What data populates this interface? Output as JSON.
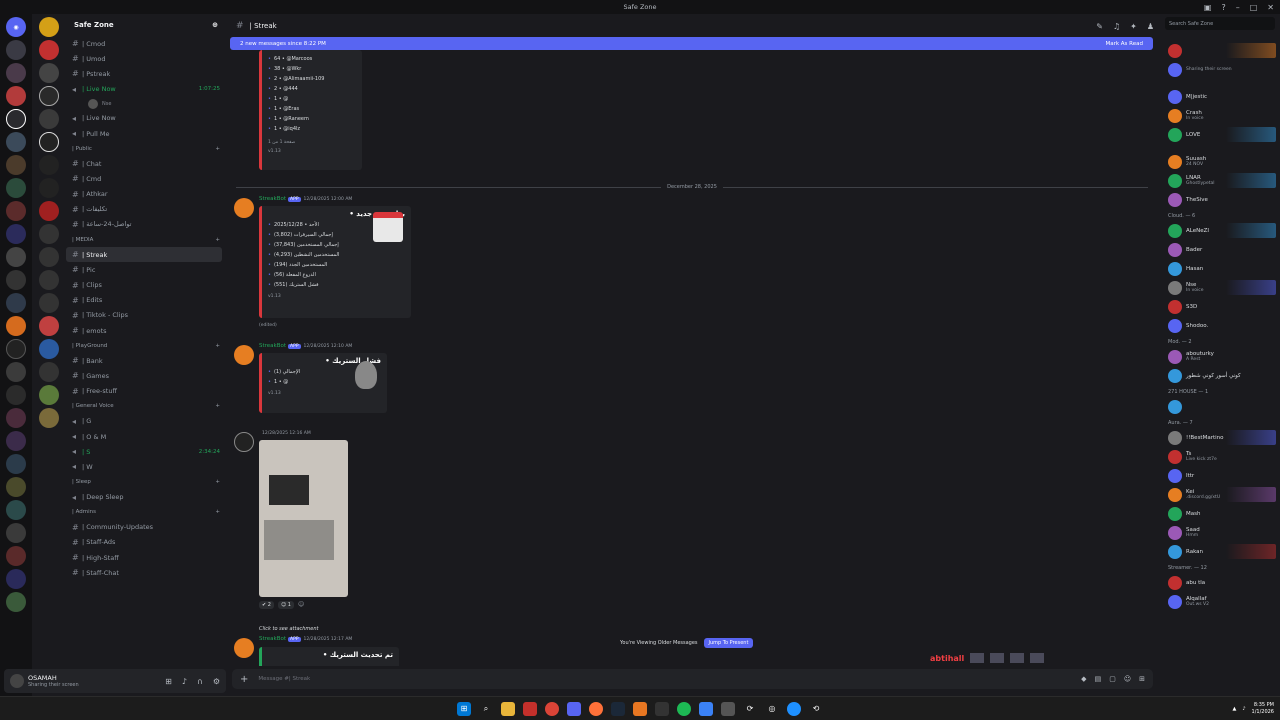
{
  "window": {
    "title": "Safe Zone"
  },
  "server": {
    "name": "Safe Zone"
  },
  "channels": [
    {
      "label": "| Cmod",
      "type": "text"
    },
    {
      "label": "| Umod",
      "type": "text"
    },
    {
      "label": "| Pstreak",
      "type": "text"
    },
    {
      "label": "| Live Now",
      "type": "voice",
      "time": "1:07:25",
      "live": true
    },
    {
      "label": "Nse",
      "type": "sub"
    },
    {
      "label": "| Live Now",
      "type": "voice"
    },
    {
      "label": "| Pull Me",
      "type": "voice"
    },
    {
      "label": "| Public",
      "type": "category"
    },
    {
      "label": "| Chat",
      "type": "text"
    },
    {
      "label": "| Cmd",
      "type": "text"
    },
    {
      "label": "| Athkar",
      "type": "text"
    },
    {
      "label": "| تكليفات",
      "type": "text"
    },
    {
      "label": "| تواصل-24-ساعة",
      "type": "text"
    },
    {
      "label": "| MEDIA",
      "type": "category"
    },
    {
      "label": "| Streak",
      "type": "text",
      "active": true
    },
    {
      "label": "| Pic",
      "type": "text"
    },
    {
      "label": "| Clips",
      "type": "text"
    },
    {
      "label": "| Edits",
      "type": "text"
    },
    {
      "label": "| Tiktok - Clips",
      "type": "text"
    },
    {
      "label": "| emots",
      "type": "text"
    },
    {
      "label": "| PlayGround",
      "type": "category"
    },
    {
      "label": "| Bank",
      "type": "text"
    },
    {
      "label": "| Games",
      "type": "text"
    },
    {
      "label": "| Free-stuff",
      "type": "text"
    },
    {
      "label": "| General Voice",
      "type": "category"
    },
    {
      "label": "| G",
      "type": "voice"
    },
    {
      "label": "| O & M",
      "type": "voice"
    },
    {
      "label": "| S",
      "type": "voice",
      "time": "2:34:24",
      "live": true
    },
    {
      "label": "| W",
      "type": "voice"
    },
    {
      "label": "| Sleep",
      "type": "category"
    },
    {
      "label": "| Deep Sleep",
      "type": "voice"
    },
    {
      "label": "| Admins",
      "type": "category"
    },
    {
      "label": "| Community-Updates",
      "type": "text"
    },
    {
      "label": "| Staff-Ads",
      "type": "text"
    },
    {
      "label": "| High-Staff",
      "type": "text"
    },
    {
      "label": "| Staff-Chat",
      "type": "text"
    }
  ],
  "user": {
    "name": "OSAMAH",
    "status": "Sharing their screen"
  },
  "chat": {
    "channel_name": "| Streak",
    "new_messages": "2 new messages since 8:22 PM",
    "mark_read": "Mark As Read",
    "day_separator": "December 28, 2025",
    "composer_placeholder": "Message #| Streak",
    "older_notice": "You're Viewing Older Messages",
    "jump_label": "Jump To Present",
    "typing_name": "abtihall"
  },
  "messages": [
    {
      "leaderboard": [
        "64 • @Marcoos",
        "38 • @Wkr",
        "2 • @Alimaamii-109",
        "2 • @444",
        "1 • @",
        "1 • @Eras",
        "1 • @Raneem",
        "1 • @iq4lz"
      ],
      "footer_text": "صفحة 1 من 1",
      "version": "v1.13"
    },
    {
      "author": "StreakBot",
      "tag": "APP",
      "time": "12/28/2025 12:00 AM",
      "title": "بداية يوم جديد •",
      "lines": [
        "الأحد • 2025/12/28",
        "إجمالي السيرفرات (3,802)",
        "إجمالي المستخدمين (37,843)",
        "المستخدمين النشطين (4,293)",
        "المستخدمين الجدد (194)",
        "الدروع المفعلة (56)",
        "فشل الستريك (551)"
      ],
      "version": "v1.13",
      "extra": "(edited)"
    },
    {
      "author": "StreakBot",
      "tag": "APP",
      "time": "12/28/2025 12:10 AM",
      "title": "فشل الستريك •",
      "lines": [
        "الإجمالي (1)",
        "1 • @"
      ],
      "version": "v1.13"
    },
    {
      "author": "",
      "time": "12/28/2025 12:16 AM",
      "reactions": [
        "2",
        "1"
      ]
    },
    {
      "author": "StreakBot",
      "tag": "APP",
      "time": "12/28/2025 12:17 AM",
      "reply": "Click to see attachment",
      "title": "تم تحديث الستريك •"
    }
  ],
  "members": {
    "search_placeholder": "Search Safe Zone",
    "groups": [
      {
        "label": "",
        "items": [
          {
            "name": "",
            "status": ""
          },
          {
            "name": "",
            "status": "Sharing their screen"
          }
        ]
      },
      {
        "label": "",
        "items": [
          {
            "name": "M|jestic",
            "status": ""
          },
          {
            "name": "Crash",
            "status": "In voice"
          },
          {
            "name": "LOVE",
            "status": ""
          }
        ]
      },
      {
        "label": "",
        "items": [
          {
            "name": "Suuash",
            "status": "24 NOV"
          },
          {
            "name": "LNAR",
            "status": "Ghostlypetal"
          },
          {
            "name": "TheSive",
            "status": ""
          }
        ]
      },
      {
        "label": "Cloud. — 6",
        "items": [
          {
            "name": "ALeNeZI",
            "status": ""
          },
          {
            "name": "Bader",
            "status": ""
          },
          {
            "name": "Hasan",
            "status": ""
          },
          {
            "name": "Nse",
            "status": "In voice"
          },
          {
            "name": "S3D",
            "status": ""
          },
          {
            "name": "Shodoo.",
            "status": ""
          }
        ]
      },
      {
        "label": "Mod. — 2",
        "items": [
          {
            "name": "abouturky",
            "status": "A Rest"
          },
          {
            "name": "كوني أسور كوني شطور",
            "status": ""
          }
        ]
      },
      {
        "label": "271 HOUSE — 1",
        "items": [
          {
            "name": "",
            "status": ""
          }
        ]
      },
      {
        "label": "Aura. — 7",
        "items": [
          {
            "name": "!!BestMartino",
            "status": ""
          },
          {
            "name": "Ts",
            "status": "Live kick zt7e"
          },
          {
            "name": "Ittr",
            "status": ""
          },
          {
            "name": "Kei",
            "status": ".discord.gg/xtU"
          },
          {
            "name": "Mash",
            "status": ""
          },
          {
            "name": "Saad",
            "status": "Hmm"
          },
          {
            "name": "Rakan",
            "status": ""
          }
        ]
      },
      {
        "label": "Streamer. — 12",
        "items": [
          {
            "name": "abu tla",
            "status": ""
          },
          {
            "name": "Alqallaf",
            "status": "Out.ws V2"
          }
        ]
      }
    ]
  },
  "taskbar": {
    "time": "8:35 PM",
    "date": "1/1/2026"
  }
}
